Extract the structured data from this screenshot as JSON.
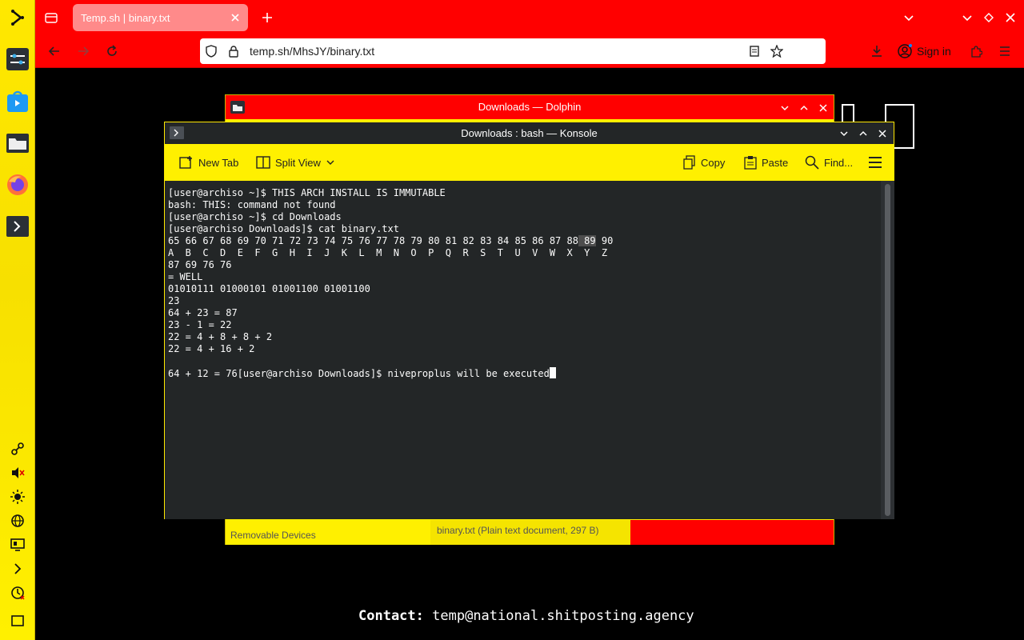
{
  "browser": {
    "tab_title": "Temp.sh | binary.txt",
    "url": "temp.sh/MhsJY/binary.txt",
    "sign_in": "Sign in"
  },
  "page": {
    "contact_label": "Contact:",
    "contact_email": "temp@national.shitposting.agency"
  },
  "dolphin": {
    "title": "Downloads — Dolphin",
    "status_left": "Removable Devices",
    "status_file": "binary.txt (Plain text document, 297 B)"
  },
  "konsole": {
    "title": "Downloads : bash — Konsole",
    "toolbar": {
      "new_tab": "New Tab",
      "split_view": "Split View",
      "copy": "Copy",
      "paste": "Paste",
      "find": "Find..."
    },
    "lines": [
      "[user@archiso ~]$ THIS ARCH INSTALL IS IMMUTABLE",
      "bash: THIS: command not found",
      "[user@archiso ~]$ cd Downloads",
      "[user@archiso Downloads]$ cat binary.txt"
    ],
    "numbers_before": "65 66 67 68 69 70 71 72 73 74 75 76 77 78 79 80 81 82 83 84 85 86 87 88",
    "numbers_highlight": " 89",
    "numbers_after": " 90",
    "lines2": [
      "A  B  C  D  E  F  G  H  I  J  K  L  M  N  O  P  Q  R  S  T  U  V  W  X  Y  Z",
      "87 69 76 76",
      "= WELL",
      "01010111 01000101 01001100 01001100",
      "23",
      "64 + 23 = 87",
      "23 - 1 = 22",
      "22 = 4 + 8 + 8 + 2",
      "22 = 4 + 16 + 2",
      ""
    ],
    "last_line": "64 + 12 = 76[user@archiso Downloads]$ niveproplus will be executed"
  },
  "colors": {
    "accent_red": "#ff0000",
    "accent_yellow": "#fff000",
    "terminal_bg": "#232627"
  }
}
